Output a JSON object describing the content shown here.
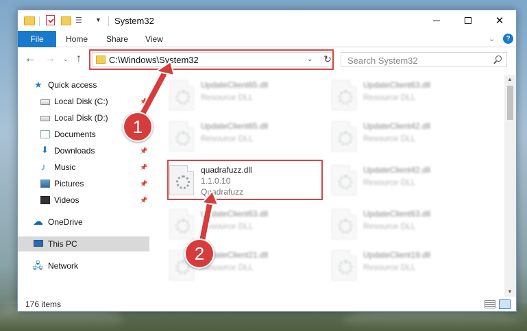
{
  "window": {
    "title": "System32",
    "controls": {
      "minimize": "",
      "maximize": "",
      "close": "✕"
    }
  },
  "quick_access_toolbar": {
    "dropdown": "▼"
  },
  "ribbon": {
    "tabs": [
      "File",
      "Home",
      "Share",
      "View"
    ],
    "collapse_chevron": "⌄",
    "help": "?"
  },
  "navigation": {
    "back": "←",
    "forward": "→",
    "recent": "⌄",
    "up": "↑",
    "address": "C:\\Windows\\System32",
    "address_dropdown": "⌄",
    "refresh": "↻",
    "search_placeholder": "Search System32"
  },
  "sidebar": {
    "items": [
      {
        "label": "Quick access",
        "icon": "star-icon",
        "pinned": false
      },
      {
        "label": "Local Disk (C:)",
        "icon": "drive-icon",
        "pinned": true
      },
      {
        "label": "Local Disk (D:)",
        "icon": "drive-icon",
        "pinned": false
      },
      {
        "label": "Documents",
        "icon": "documents-icon",
        "pinned": false
      },
      {
        "label": "Downloads",
        "icon": "download-icon",
        "pinned": true
      },
      {
        "label": "Music",
        "icon": "music-icon",
        "pinned": true
      },
      {
        "label": "Pictures",
        "icon": "pictures-icon",
        "pinned": true
      },
      {
        "label": "Videos",
        "icon": "videos-icon",
        "pinned": true
      },
      {
        "label": "OneDrive",
        "icon": "onedrive-icon",
        "pinned": false
      },
      {
        "label": "This PC",
        "icon": "this-pc-icon",
        "pinned": false,
        "selected": true
      },
      {
        "label": "Network",
        "icon": "network-icon",
        "pinned": false
      }
    ],
    "pin_glyph": "📌"
  },
  "files": [
    {
      "name": "UpdateClient65.dll",
      "sub": "Resource DLL",
      "blurred": true
    },
    {
      "name": "UpdateClient63.dll",
      "sub": "Resource DLL",
      "blurred": true
    },
    {
      "name": "UpdateClient65.dll",
      "sub": "Resource DLL",
      "blurred": true
    },
    {
      "name": "UpdateClient42.dll",
      "sub": "Resource DLL",
      "blurred": true
    },
    {
      "name": "quadrafuzz.dll",
      "version": "1.1.0.10",
      "sub": "Quadrafuzz",
      "blurred": false
    },
    {
      "name": "UpdateClient42.dll",
      "sub": "Resource DLL",
      "blurred": true
    },
    {
      "name": "UpdateClient63.dll",
      "sub": "Resource DLL",
      "blurred": true
    },
    {
      "name": "UpdateClient63.dll",
      "sub": "Resource DLL",
      "blurred": true
    },
    {
      "name": "UpdateClient21.dll",
      "sub": "Resource DLL",
      "blurred": true
    },
    {
      "name": "UpdateClient19.dll",
      "sub": "Resource DLL",
      "blurred": true
    }
  ],
  "status": {
    "items_count": "176 items"
  },
  "annotations": {
    "step1": "1",
    "step2": "2",
    "highlight_color": "#d64545"
  }
}
